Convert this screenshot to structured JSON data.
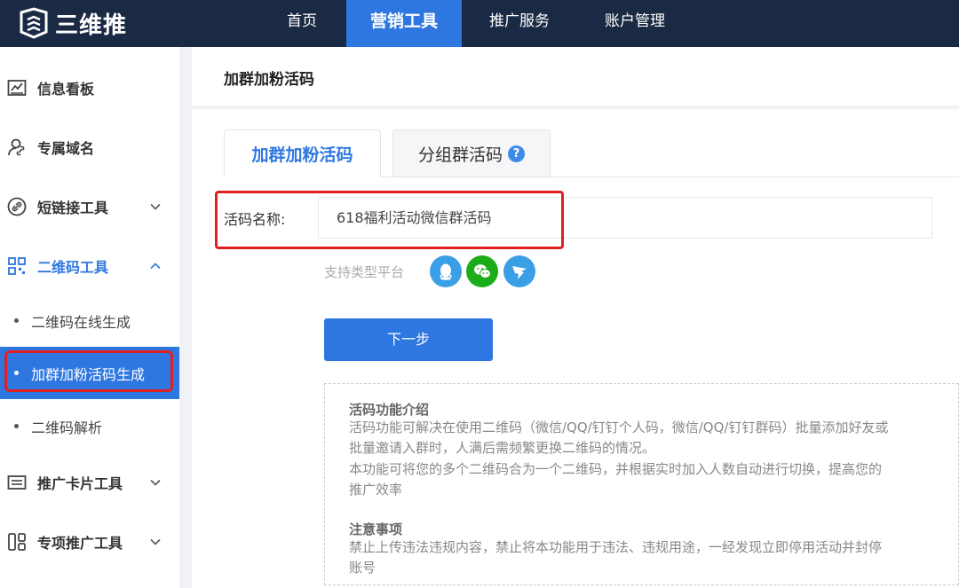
{
  "header": {
    "logo_text": "三维推",
    "nav": [
      "首页",
      "营销工具",
      "推广服务",
      "账户管理"
    ]
  },
  "sidebar": {
    "items": [
      {
        "label": "信息看板",
        "icon": "chart-board-icon"
      },
      {
        "label": "专属域名",
        "icon": "user-link-icon"
      },
      {
        "label": "短链接工具",
        "icon": "link-icon"
      },
      {
        "label": "二维码工具",
        "icon": "qrcode-icon"
      },
      {
        "label": "推广卡片工具",
        "icon": "card-icon"
      },
      {
        "label": "专项推广工具",
        "icon": "layout-icon"
      }
    ],
    "sub_items": [
      "二维码在线生成",
      "加群加粉活码生成",
      "二维码解析"
    ]
  },
  "page": {
    "title": "加群加粉活码",
    "tabs": [
      "加群加粉活码",
      "分组群活码"
    ],
    "help_glyph": "?"
  },
  "form": {
    "name_label": "活码名称:",
    "name_value": "618福利活动微信群活码",
    "platform_label": "支持类型平台",
    "platforms": [
      "qq",
      "wechat",
      "dingtalk"
    ],
    "next_button": "下一步"
  },
  "info": {
    "intro_title": "活码功能介绍",
    "intro_line1": "活码功能可解决在使用二维码（微信/QQ/钉钉个人码，微信/QQ/钉钉群码）批量添加好友或",
    "intro_line2": "批量邀请入群时，人满后需频繁更换二维码的情况。",
    "intro_line3": "本功能可将您的多个二维码合为一个二维码，并根据实时加入人数自动进行切换，提高您的",
    "intro_line4": "推广效率",
    "notice_title": "注意事项",
    "notice_line1": "禁止上传违法违规内容，禁止将本功能用于违法、违规用途，一经发现立即停用活动并封停",
    "notice_line2": "账号"
  },
  "colors": {
    "topbar": "#1b2a44",
    "accent": "#2e77e0",
    "highlight_border": "#e02020"
  }
}
